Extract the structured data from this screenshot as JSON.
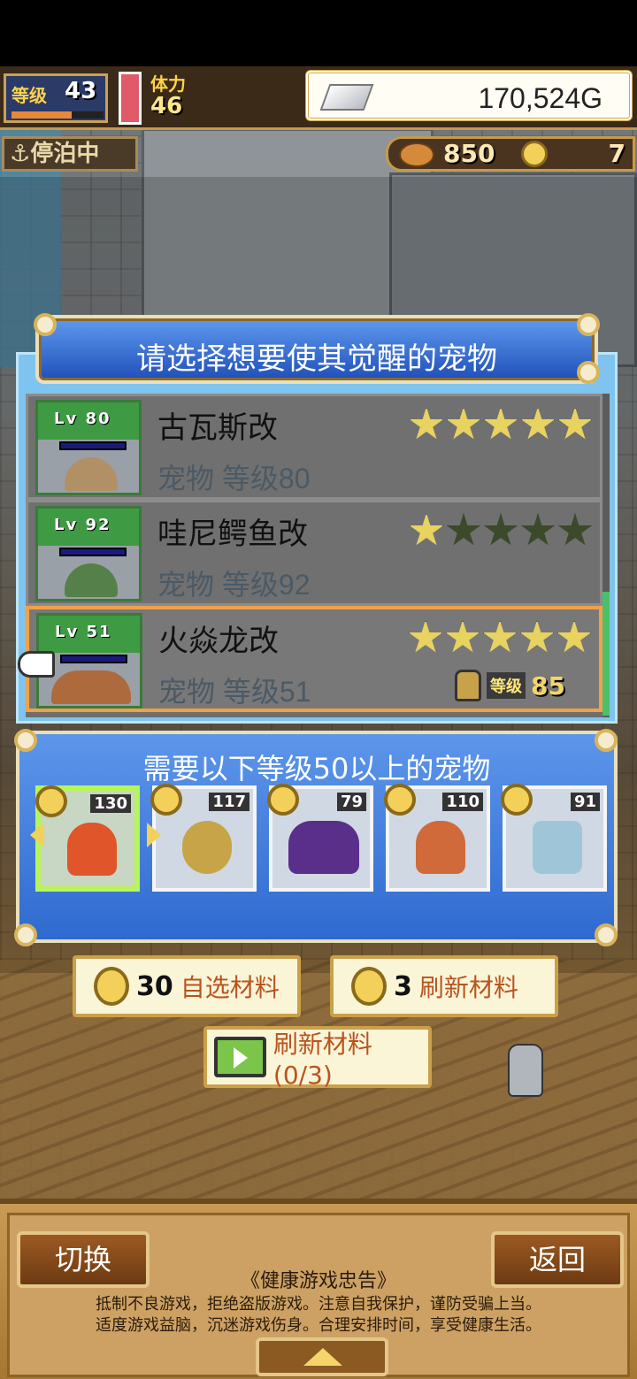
{
  "hud": {
    "level_label": "等级",
    "level_value": "43",
    "level_progress": 0.65,
    "stamina_label": "体力",
    "stamina_value": "46",
    "gold_value": "170,524G",
    "status_badge": "停泊中",
    "resource_1": "850",
    "resource_2": "7"
  },
  "modal": {
    "title": "请选择想要使其觉醒的宠物",
    "pets": [
      {
        "lv_label": "Lv",
        "lv_value": "80",
        "name": "古瓦斯改",
        "sub": "宠物 等级80",
        "stars": 5,
        "locked": false
      },
      {
        "lv_label": "Lv",
        "lv_value": "92",
        "name": "哇尼鳄鱼改",
        "sub": "宠物 等级92",
        "stars": 1,
        "locked": false
      },
      {
        "lv_label": "Lv",
        "lv_value": "51",
        "name": "火焱龙改",
        "sub": "宠物 等级51",
        "stars": 5,
        "locked": true,
        "lock_label": "等级",
        "lock_value": "85"
      }
    ],
    "requirements": {
      "title": "需要以下等级50以上的宠物",
      "materials": [
        {
          "level": "130",
          "art": "fire-spirit"
        },
        {
          "level": "117",
          "art": "clam"
        },
        {
          "level": "79",
          "art": "purple-ogre"
        },
        {
          "level": "110",
          "art": "octopus"
        },
        {
          "level": "91",
          "art": "fish"
        }
      ]
    },
    "actions": {
      "select_cost": "30",
      "select_label": "自选材料",
      "refresh_cost": "3",
      "refresh_label": "刷新材料",
      "ad_refresh_label": "刷新材料(0/3)"
    }
  },
  "bottom": {
    "switch_label": "切换",
    "back_label": "返回",
    "notice_title": "《健康游戏忠告》",
    "notice_line_1": "抵制不良游戏，拒绝盗版游戏。注意自我保护，谨防受骗上当。",
    "notice_line_2": "适度游戏益脑，沉迷游戏伤身。合理安排时间，享受健康生活。"
  },
  "colors": {
    "accent_blue": "#2f6ad0",
    "selected_border": "#f0a14a",
    "selected_material": "#b7f55a",
    "gold": "#f2d05a"
  }
}
